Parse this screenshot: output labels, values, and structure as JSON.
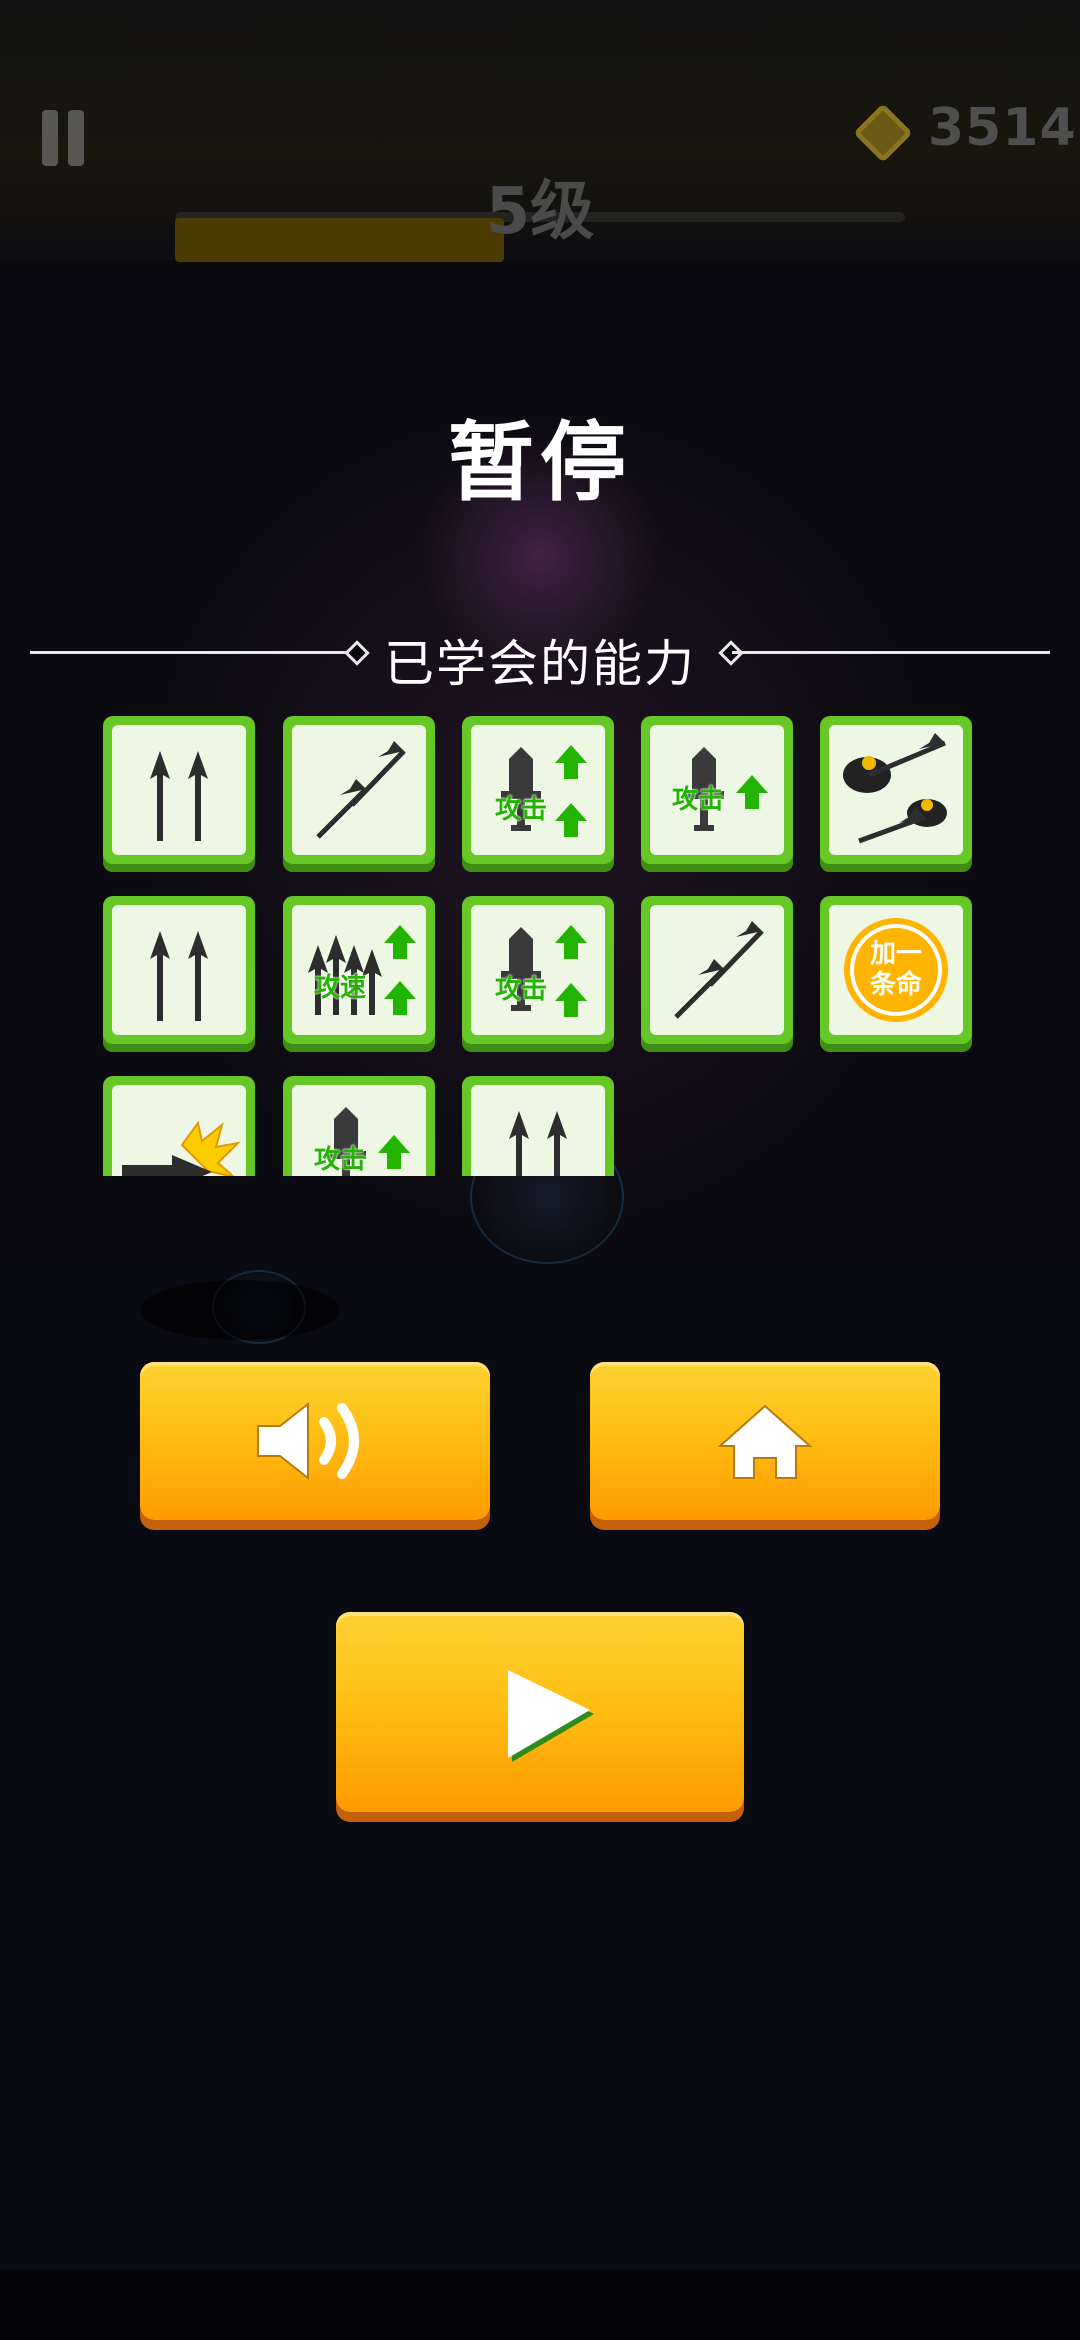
{
  "hud": {
    "coins": "3514",
    "level_label": "5级",
    "level_progress": 0.45,
    "pause_icon": "pause-icon",
    "coin_icon": "diamond-coin-icon"
  },
  "overlay": {
    "title": "暂停",
    "abilities_header": "已学会的能力"
  },
  "abilities": [
    {
      "icon": "double-arrow-icon",
      "text": ""
    },
    {
      "icon": "diagonal-arrow-icon",
      "text": ""
    },
    {
      "icon": "attack-up-double-icon",
      "text": "攻击"
    },
    {
      "icon": "attack-up-icon",
      "text": "攻击"
    },
    {
      "icon": "ricochet-arrow-icon",
      "text": ""
    },
    {
      "icon": "double-arrow-icon",
      "text": ""
    },
    {
      "icon": "attack-speed-up-icon",
      "text": "攻速"
    },
    {
      "icon": "attack-up-double-icon",
      "text": "攻击"
    },
    {
      "icon": "diagonal-arrow-icon",
      "text": ""
    },
    {
      "icon": "extra-life-icon",
      "text": "加一条命"
    },
    {
      "icon": "critical-arrow-icon",
      "text": ""
    },
    {
      "icon": "attack-up-icon",
      "text": "攻击"
    },
    {
      "icon": "double-arrow-icon",
      "text": ""
    }
  ],
  "buttons": {
    "sound": {
      "icon": "speaker-icon"
    },
    "home": {
      "icon": "home-icon"
    },
    "resume": {
      "icon": "play-icon"
    }
  },
  "colors": {
    "tile_green": "#66c827",
    "button_orange": "#ffbf14",
    "arrow_green": "#22b400"
  }
}
